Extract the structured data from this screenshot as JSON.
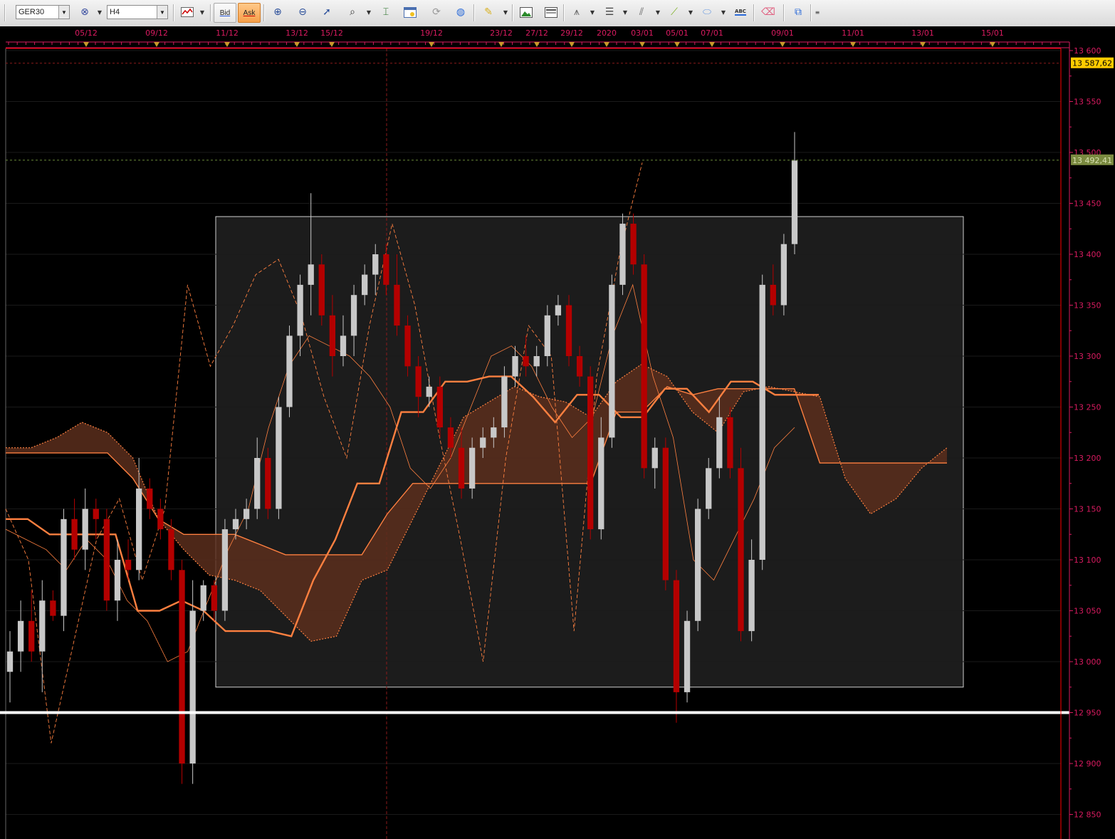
{
  "toolbar": {
    "symbol": "GER30",
    "timeframe": "H4",
    "bid_label": "Bid",
    "ask_label": "Ask",
    "abc_label": "ABC"
  },
  "chart": {
    "date_labels": [
      "05/12",
      "09/12",
      "11/12",
      "13/12",
      "15/12",
      "19/12",
      "23/12",
      "27/12",
      "29/12",
      "2020",
      "03/01",
      "05/01",
      "07/01",
      "09/01",
      "11/01",
      "13/01",
      "15/01"
    ],
    "price_labels": [
      "13 600",
      "13 550",
      "13 500",
      "13 450",
      "13 400",
      "13 350",
      "13 300",
      "13 250",
      "13 200",
      "13 150",
      "13 100",
      "13 050",
      "13 000",
      "12 950",
      "12 900",
      "12 850"
    ],
    "price_tag_top": "13 587,62",
    "price_tag_current": "13 492,41",
    "colors": {
      "bull": "#c8c8c8",
      "bear": "#b40000",
      "kijun": "#ff8040",
      "cloud": "#5a2e1c",
      "axis": "#d81b60"
    }
  },
  "chart_data": {
    "type": "candlestick",
    "title": "",
    "ylim": [
      12830,
      13610
    ],
    "categories": [
      "05/12",
      "09/12",
      "11/12",
      "13/12",
      "15/12",
      "19/12",
      "23/12",
      "27/12",
      "29/12",
      "2020",
      "03/01",
      "05/01",
      "07/01",
      "09/01",
      "11/01",
      "13/01",
      "15/01"
    ],
    "series": [
      {
        "name": "",
        "values": [
          {
            "o": 12990,
            "h": 13030,
            "l": 12960,
            "c": 13010
          },
          {
            "o": 13010,
            "h": 13060,
            "l": 12990,
            "c": 13040
          },
          {
            "o": 13040,
            "h": 13070,
            "l": 13000,
            "c": 13010
          },
          {
            "o": 13010,
            "h": 13080,
            "l": 12970,
            "c": 13060
          },
          {
            "o": 13060,
            "h": 13070,
            "l": 13040,
            "c": 13045
          },
          {
            "o": 13045,
            "h": 13150,
            "l": 13030,
            "c": 13140
          },
          {
            "o": 13140,
            "h": 13160,
            "l": 13100,
            "c": 13110
          },
          {
            "o": 13110,
            "h": 13170,
            "l": 13090,
            "c": 13150
          },
          {
            "o": 13150,
            "h": 13160,
            "l": 13120,
            "c": 13140
          },
          {
            "o": 13140,
            "h": 13150,
            "l": 13050,
            "c": 13060
          },
          {
            "o": 13060,
            "h": 13120,
            "l": 13040,
            "c": 13100
          },
          {
            "o": 13100,
            "h": 13120,
            "l": 13080,
            "c": 13090
          },
          {
            "o": 13090,
            "h": 13200,
            "l": 13080,
            "c": 13170
          },
          {
            "o": 13170,
            "h": 13180,
            "l": 13140,
            "c": 13150
          },
          {
            "o": 13150,
            "h": 13160,
            "l": 13120,
            "c": 13130
          },
          {
            "o": 13130,
            "h": 13140,
            "l": 13080,
            "c": 13090
          },
          {
            "o": 13090,
            "h": 13100,
            "l": 12880,
            "c": 12900
          },
          {
            "o": 12900,
            "h": 13080,
            "l": 12880,
            "c": 13050
          },
          {
            "o": 13050,
            "h": 13080,
            "l": 13040,
            "c": 13075
          },
          {
            "o": 13075,
            "h": 13080,
            "l": 13040,
            "c": 13050
          },
          {
            "o": 13050,
            "h": 13140,
            "l": 13040,
            "c": 13130
          },
          {
            "o": 13130,
            "h": 13150,
            "l": 13120,
            "c": 13140
          },
          {
            "o": 13140,
            "h": 13160,
            "l": 13130,
            "c": 13150
          },
          {
            "o": 13150,
            "h": 13220,
            "l": 13140,
            "c": 13200
          },
          {
            "o": 13200,
            "h": 13210,
            "l": 13140,
            "c": 13150
          },
          {
            "o": 13150,
            "h": 13260,
            "l": 13140,
            "c": 13250
          },
          {
            "o": 13250,
            "h": 13330,
            "l": 13240,
            "c": 13320
          },
          {
            "o": 13320,
            "h": 13380,
            "l": 13300,
            "c": 13370
          },
          {
            "o": 13370,
            "h": 13460,
            "l": 13340,
            "c": 13390
          },
          {
            "o": 13390,
            "h": 13400,
            "l": 13330,
            "c": 13340
          },
          {
            "o": 13340,
            "h": 13360,
            "l": 13280,
            "c": 13300
          },
          {
            "o": 13300,
            "h": 13340,
            "l": 13290,
            "c": 13320
          },
          {
            "o": 13320,
            "h": 13370,
            "l": 13300,
            "c": 13360
          },
          {
            "o": 13360,
            "h": 13390,
            "l": 13350,
            "c": 13380
          },
          {
            "o": 13380,
            "h": 13410,
            "l": 13360,
            "c": 13400
          },
          {
            "o": 13400,
            "h": 13410,
            "l": 13360,
            "c": 13370
          },
          {
            "o": 13370,
            "h": 13400,
            "l": 13320,
            "c": 13330
          },
          {
            "o": 13330,
            "h": 13340,
            "l": 13280,
            "c": 13290
          },
          {
            "o": 13290,
            "h": 13300,
            "l": 13240,
            "c": 13260
          },
          {
            "o": 13260,
            "h": 13280,
            "l": 13250,
            "c": 13270
          },
          {
            "o": 13270,
            "h": 13280,
            "l": 13220,
            "c": 13230
          },
          {
            "o": 13230,
            "h": 13240,
            "l": 13200,
            "c": 13210
          },
          {
            "o": 13210,
            "h": 13230,
            "l": 13160,
            "c": 13170
          },
          {
            "o": 13170,
            "h": 13220,
            "l": 13160,
            "c": 13210
          },
          {
            "o": 13210,
            "h": 13230,
            "l": 13200,
            "c": 13220
          },
          {
            "o": 13220,
            "h": 13240,
            "l": 13210,
            "c": 13230
          },
          {
            "o": 13230,
            "h": 13290,
            "l": 13220,
            "c": 13280
          },
          {
            "o": 13280,
            "h": 13310,
            "l": 13270,
            "c": 13300
          },
          {
            "o": 13300,
            "h": 13320,
            "l": 13280,
            "c": 13290
          },
          {
            "o": 13290,
            "h": 13310,
            "l": 13280,
            "c": 13300
          },
          {
            "o": 13300,
            "h": 13350,
            "l": 13290,
            "c": 13340
          },
          {
            "o": 13340,
            "h": 13360,
            "l": 13330,
            "c": 13350
          },
          {
            "o": 13350,
            "h": 13360,
            "l": 13290,
            "c": 13300
          },
          {
            "o": 13300,
            "h": 13310,
            "l": 13270,
            "c": 13280
          },
          {
            "o": 13280,
            "h": 13290,
            "l": 13120,
            "c": 13130
          },
          {
            "o": 13130,
            "h": 13240,
            "l": 13120,
            "c": 13220
          },
          {
            "o": 13220,
            "h": 13380,
            "l": 13210,
            "c": 13370
          },
          {
            "o": 13370,
            "h": 13440,
            "l": 13360,
            "c": 13430
          },
          {
            "o": 13430,
            "h": 13440,
            "l": 13380,
            "c": 13390
          },
          {
            "o": 13390,
            "h": 13400,
            "l": 13180,
            "c": 13190
          },
          {
            "o": 13190,
            "h": 13220,
            "l": 13170,
            "c": 13210
          },
          {
            "o": 13210,
            "h": 13220,
            "l": 13070,
            "c": 13080
          },
          {
            "o": 13080,
            "h": 13090,
            "l": 12940,
            "c": 12970
          },
          {
            "o": 12970,
            "h": 13050,
            "l": 12960,
            "c": 13040
          },
          {
            "o": 13040,
            "h": 13160,
            "l": 13030,
            "c": 13150
          },
          {
            "o": 13150,
            "h": 13200,
            "l": 13140,
            "c": 13190
          },
          {
            "o": 13190,
            "h": 13260,
            "l": 13180,
            "c": 13240
          },
          {
            "o": 13240,
            "h": 13250,
            "l": 13180,
            "c": 13190
          },
          {
            "o": 13190,
            "h": 13210,
            "l": 13020,
            "c": 13030
          },
          {
            "o": 13030,
            "h": 13120,
            "l": 13020,
            "c": 13100
          },
          {
            "o": 13100,
            "h": 13380,
            "l": 13090,
            "c": 13370
          },
          {
            "o": 13370,
            "h": 13390,
            "l": 13340,
            "c": 13350
          },
          {
            "o": 13350,
            "h": 13420,
            "l": 13340,
            "c": 13410
          },
          {
            "o": 13410,
            "h": 13520,
            "l": 13400,
            "c": 13492
          }
        ]
      }
    ],
    "levels": [
      13587.62,
      13492.41,
      12950
    ]
  }
}
